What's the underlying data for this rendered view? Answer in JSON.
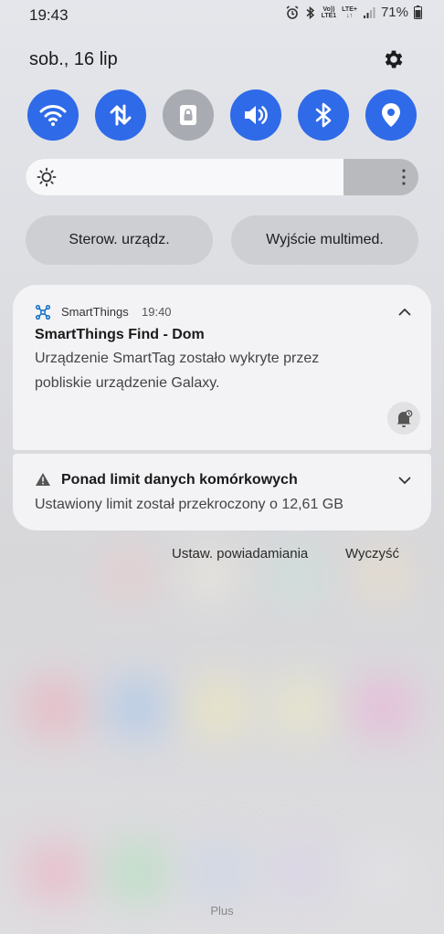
{
  "status_bar": {
    "time": "19:43",
    "volte_top": "Vo))",
    "volte_bottom": "LTE1",
    "network": "LTE+",
    "battery": "71%"
  },
  "header": {
    "date": "sob., 16 lip"
  },
  "quick_settings": {
    "accent_color": "#2f6ae8",
    "tiles": [
      {
        "icon": "wifi-icon",
        "state": "on"
      },
      {
        "icon": "mobile-data-icon",
        "state": "on"
      },
      {
        "icon": "lock-screen-rotation-icon",
        "state": "off"
      },
      {
        "icon": "sound-icon",
        "state": "on"
      },
      {
        "icon": "bluetooth-icon",
        "state": "on"
      },
      {
        "icon": "location-icon",
        "state": "on"
      }
    ]
  },
  "brightness": {
    "level_percent": 81
  },
  "shortcuts": {
    "device_control": "Sterow. urządz.",
    "media_output": "Wyjście multimed."
  },
  "notifications": [
    {
      "app_name": "SmartThings",
      "time": "19:40",
      "title": "SmartThings Find - Dom",
      "body_line1": "Urządzenie SmartTag zostało wykryte przez",
      "body_line2": "pobliskie urządzenie Galaxy."
    },
    {
      "title": "Ponad limit danych komórkowych",
      "body": "Ustawiony limit został przekroczony o 12,61 GB"
    }
  ],
  "actions": {
    "settings": "Ustaw. powiadamiania",
    "clear": "Wyczyść"
  },
  "footer": {
    "plus": "Plus"
  }
}
